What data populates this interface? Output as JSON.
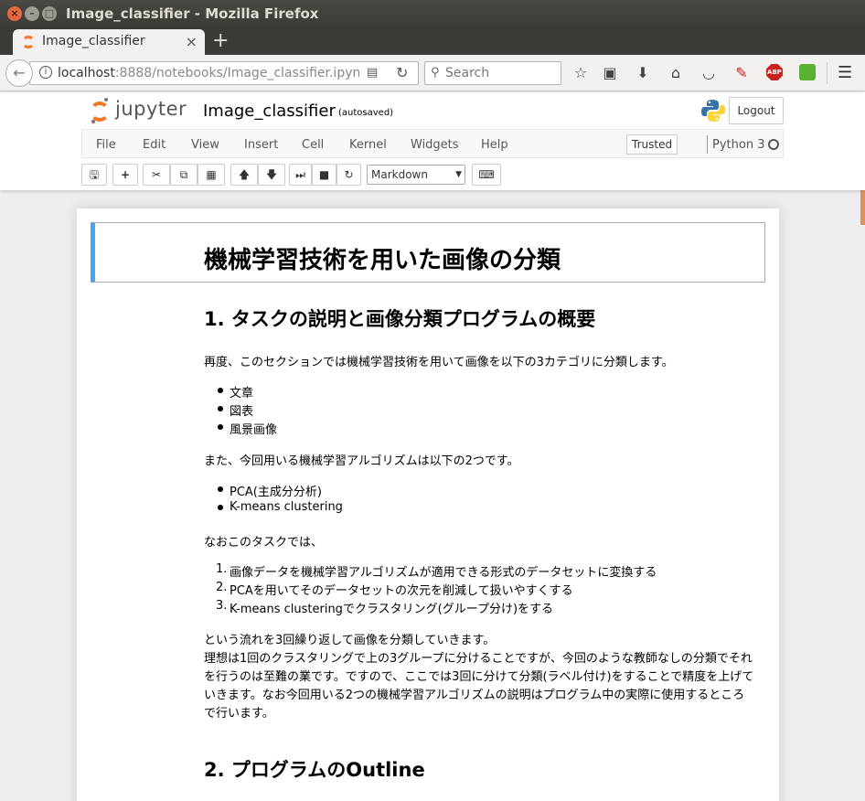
{
  "window": {
    "title": "Image_classifier - Mozilla Firefox"
  },
  "browser": {
    "tab_title": "Image_classifier",
    "url_host": "localhost",
    "url_path": ":8888/notebooks/Image_classifier.ipynb",
    "search_placeholder": "Search"
  },
  "jupyter": {
    "logo_text": "jupyter",
    "notebook_name": "Image_classifier",
    "autosave_status": "(autosaved)",
    "logout_label": "Logout",
    "menu": [
      "File",
      "Edit",
      "View",
      "Insert",
      "Cell",
      "Kernel",
      "Widgets",
      "Help"
    ],
    "trusted_label": "Trusted",
    "kernel_name": "Python 3",
    "cell_type": "Markdown"
  },
  "notebook": {
    "h1": "機械学習技術を用いた画像の分類",
    "section1_title": "1. タスクの説明と画像分類プログラムの概要",
    "intro": "再度、このセクションでは機械学習技術を用いて画像を以下の3カテゴリに分類します。",
    "categories": [
      "文章",
      "図表",
      "風景画像"
    ],
    "algo_intro": "また、今回用いる機械学習アルゴリズムは以下の2つです。",
    "algorithms": [
      "PCA(主成分分析)",
      "K-means clustering"
    ],
    "task_intro": "なおこのタスクでは、",
    "steps": [
      "画像データを機械学習アルゴリズムが適用できる形式のデータセットに変換する",
      "PCAを用いてそのデータセットの次元を削減して扱いやすくする",
      "K-means clusteringでクラスタリング(グループ分け)をする"
    ],
    "para_lines": [
      "という流れを3回繰り返して画像を分類していきます。",
      "理想は1回のクラスタリングで上の3グループに分けることですが、今回のような教師なしの分類でそれ",
      "を行うのは至難の業です。ですので、ここでは3回に分けて分類(ラベル付け)をすることで精度を上げて",
      "いきます。なお今回用いる2つの機械学習アルゴリズムの説明はプログラム中の実際に使用するところ",
      "で行います。"
    ],
    "section2_title": "2. プログラムのOutline"
  },
  "colors": {
    "jupyter_orange": "#f37726",
    "selected_cell_border": "#42a5f5"
  }
}
